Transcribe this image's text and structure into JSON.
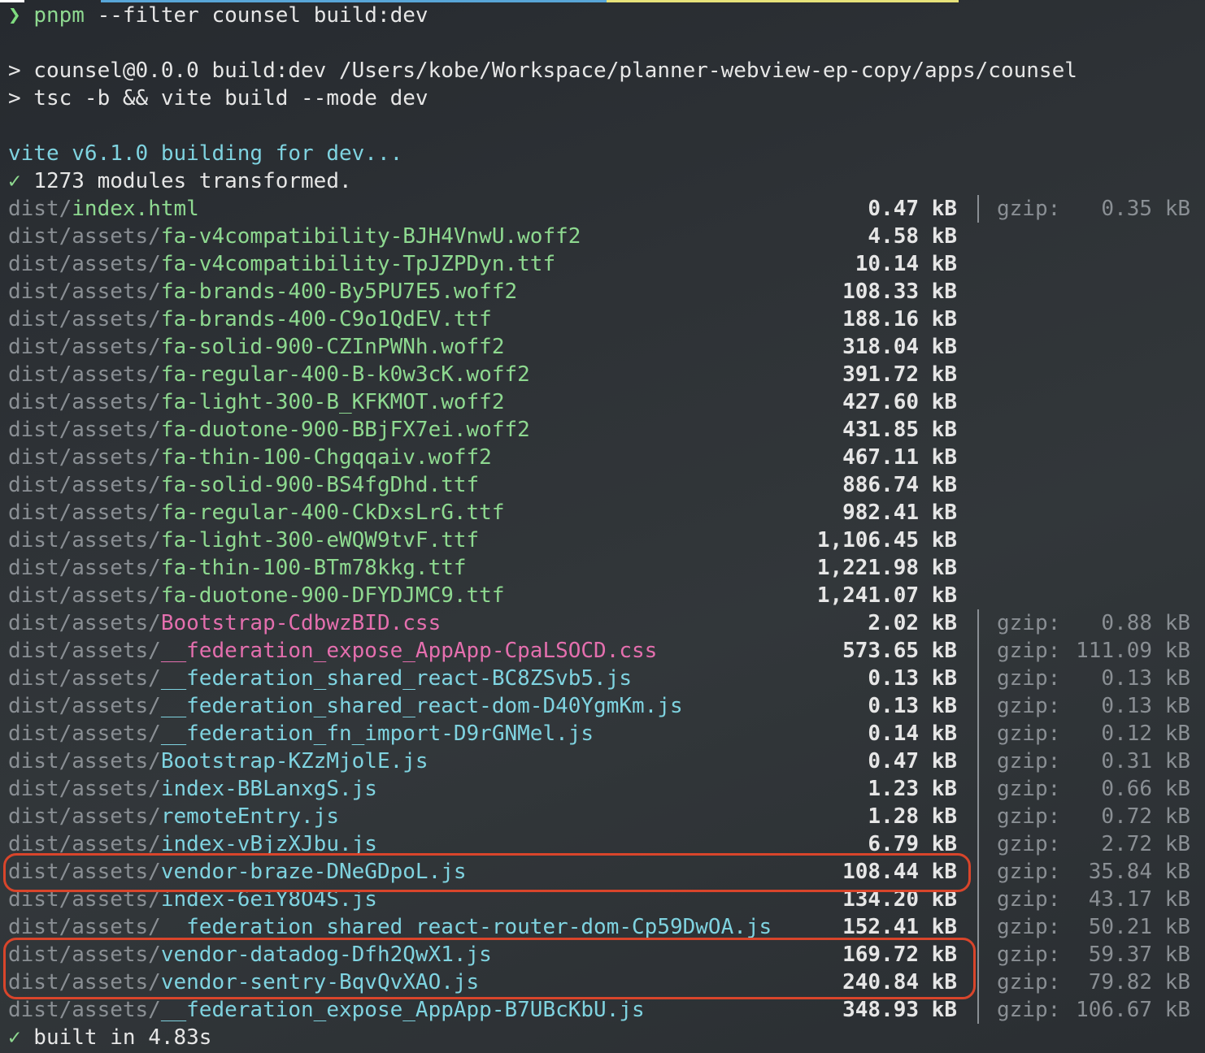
{
  "command": {
    "prompt": "❯",
    "tool": "pnpm",
    "args": " --filter counsel build:dev"
  },
  "script_lines": [
    "> counsel@0.0.0 build:dev /Users/kobe/Workspace/planner-webview-ep-copy/apps/counsel",
    "> tsc -b && vite build --mode dev"
  ],
  "vite_line": "vite v6.1.0 building for dev...",
  "transformed_line": {
    "check": "✓",
    "text": " 1273 modules transformed."
  },
  "files": [
    {
      "dir": "dist/",
      "name": "index.html",
      "color": "green",
      "size": "0.47 kB",
      "gzip": "0.35 kB"
    },
    {
      "dir": "dist/assets/",
      "name": "fa-v4compatibility-BJH4VnwU.woff2",
      "color": "green",
      "size": "4.58 kB",
      "gzip": ""
    },
    {
      "dir": "dist/assets/",
      "name": "fa-v4compatibility-TpJZPDyn.ttf",
      "color": "green",
      "size": "10.14 kB",
      "gzip": ""
    },
    {
      "dir": "dist/assets/",
      "name": "fa-brands-400-By5PU7E5.woff2",
      "color": "green",
      "size": "108.33 kB",
      "gzip": ""
    },
    {
      "dir": "dist/assets/",
      "name": "fa-brands-400-C9o1QdEV.ttf",
      "color": "green",
      "size": "188.16 kB",
      "gzip": ""
    },
    {
      "dir": "dist/assets/",
      "name": "fa-solid-900-CZInPWNh.woff2",
      "color": "green",
      "size": "318.04 kB",
      "gzip": ""
    },
    {
      "dir": "dist/assets/",
      "name": "fa-regular-400-B-k0w3cK.woff2",
      "color": "green",
      "size": "391.72 kB",
      "gzip": ""
    },
    {
      "dir": "dist/assets/",
      "name": "fa-light-300-B_KFKMOT.woff2",
      "color": "green",
      "size": "427.60 kB",
      "gzip": ""
    },
    {
      "dir": "dist/assets/",
      "name": "fa-duotone-900-BBjFX7ei.woff2",
      "color": "green",
      "size": "431.85 kB",
      "gzip": ""
    },
    {
      "dir": "dist/assets/",
      "name": "fa-thin-100-Chgqqaiv.woff2",
      "color": "green",
      "size": "467.11 kB",
      "gzip": ""
    },
    {
      "dir": "dist/assets/",
      "name": "fa-solid-900-BS4fgDhd.ttf",
      "color": "green",
      "size": "886.74 kB",
      "gzip": ""
    },
    {
      "dir": "dist/assets/",
      "name": "fa-regular-400-CkDxsLrG.ttf",
      "color": "green",
      "size": "982.41 kB",
      "gzip": ""
    },
    {
      "dir": "dist/assets/",
      "name": "fa-light-300-eWQW9tvF.ttf",
      "color": "green",
      "size": "1,106.45 kB",
      "gzip": ""
    },
    {
      "dir": "dist/assets/",
      "name": "fa-thin-100-BTm78kkg.ttf",
      "color": "green",
      "size": "1,221.98 kB",
      "gzip": ""
    },
    {
      "dir": "dist/assets/",
      "name": "fa-duotone-900-DFYDJMC9.ttf",
      "color": "green",
      "size": "1,241.07 kB",
      "gzip": ""
    },
    {
      "dir": "dist/assets/",
      "name": "Bootstrap-CdbwzBID.css",
      "color": "pink",
      "size": "2.02 kB",
      "gzip": "0.88 kB"
    },
    {
      "dir": "dist/assets/",
      "name": "__federation_expose_AppApp-CpaLSOCD.css",
      "color": "pink",
      "size": "573.65 kB",
      "gzip": "111.09 kB"
    },
    {
      "dir": "dist/assets/",
      "name": "__federation_shared_react-BC8ZSvb5.js",
      "color": "cyan",
      "size": "0.13 kB",
      "gzip": "0.13 kB"
    },
    {
      "dir": "dist/assets/",
      "name": "__federation_shared_react-dom-D40YgmKm.js",
      "color": "cyan",
      "size": "0.13 kB",
      "gzip": "0.13 kB"
    },
    {
      "dir": "dist/assets/",
      "name": "__federation_fn_import-D9rGNMel.js",
      "color": "cyan",
      "size": "0.14 kB",
      "gzip": "0.12 kB"
    },
    {
      "dir": "dist/assets/",
      "name": "Bootstrap-KZzMjolE.js",
      "color": "cyan",
      "size": "0.47 kB",
      "gzip": "0.31 kB"
    },
    {
      "dir": "dist/assets/",
      "name": "index-BBLanxgS.js",
      "color": "cyan",
      "size": "1.23 kB",
      "gzip": "0.66 kB"
    },
    {
      "dir": "dist/assets/",
      "name": "remoteEntry.js",
      "color": "cyan",
      "size": "1.28 kB",
      "gzip": "0.72 kB"
    },
    {
      "dir": "dist/assets/",
      "name": "index-vBjzXJbu.js",
      "color": "cyan",
      "size": "6.79 kB",
      "gzip": "2.72 kB"
    },
    {
      "dir": "dist/assets/",
      "name": "vendor-braze-DNeGDpoL.js",
      "color": "cyan",
      "size": "108.44 kB",
      "gzip": "35.84 kB"
    },
    {
      "dir": "dist/assets/",
      "name": "index-6eiY8O4S.js",
      "color": "cyan",
      "size": "134.20 kB",
      "gzip": "43.17 kB"
    },
    {
      "dir": "dist/assets/",
      "name": "__federation_shared_react-router-dom-Cp59DwOA.js",
      "color": "cyan",
      "size": "152.41 kB",
      "gzip": "50.21 kB"
    },
    {
      "dir": "dist/assets/",
      "name": "vendor-datadog-Dfh2QwX1.js",
      "color": "cyan",
      "size": "169.72 kB",
      "gzip": "59.37 kB"
    },
    {
      "dir": "dist/assets/",
      "name": "vendor-sentry-BqvQvXAO.js",
      "color": "cyan",
      "size": "240.84 kB",
      "gzip": "79.82 kB"
    },
    {
      "dir": "dist/assets/",
      "name": "__federation_expose_AppApp-B7UBcKbU.js",
      "color": "cyan",
      "size": "348.93 kB",
      "gzip": "106.67 kB"
    }
  ],
  "gzip_label": "gzip:",
  "built_line": {
    "check": "✓",
    "text": " built in 4.83s"
  },
  "colors": {
    "highlight": "#d9452b",
    "green": "#8ed990",
    "pink": "#e46fae",
    "cyan": "#7fd3e0"
  }
}
